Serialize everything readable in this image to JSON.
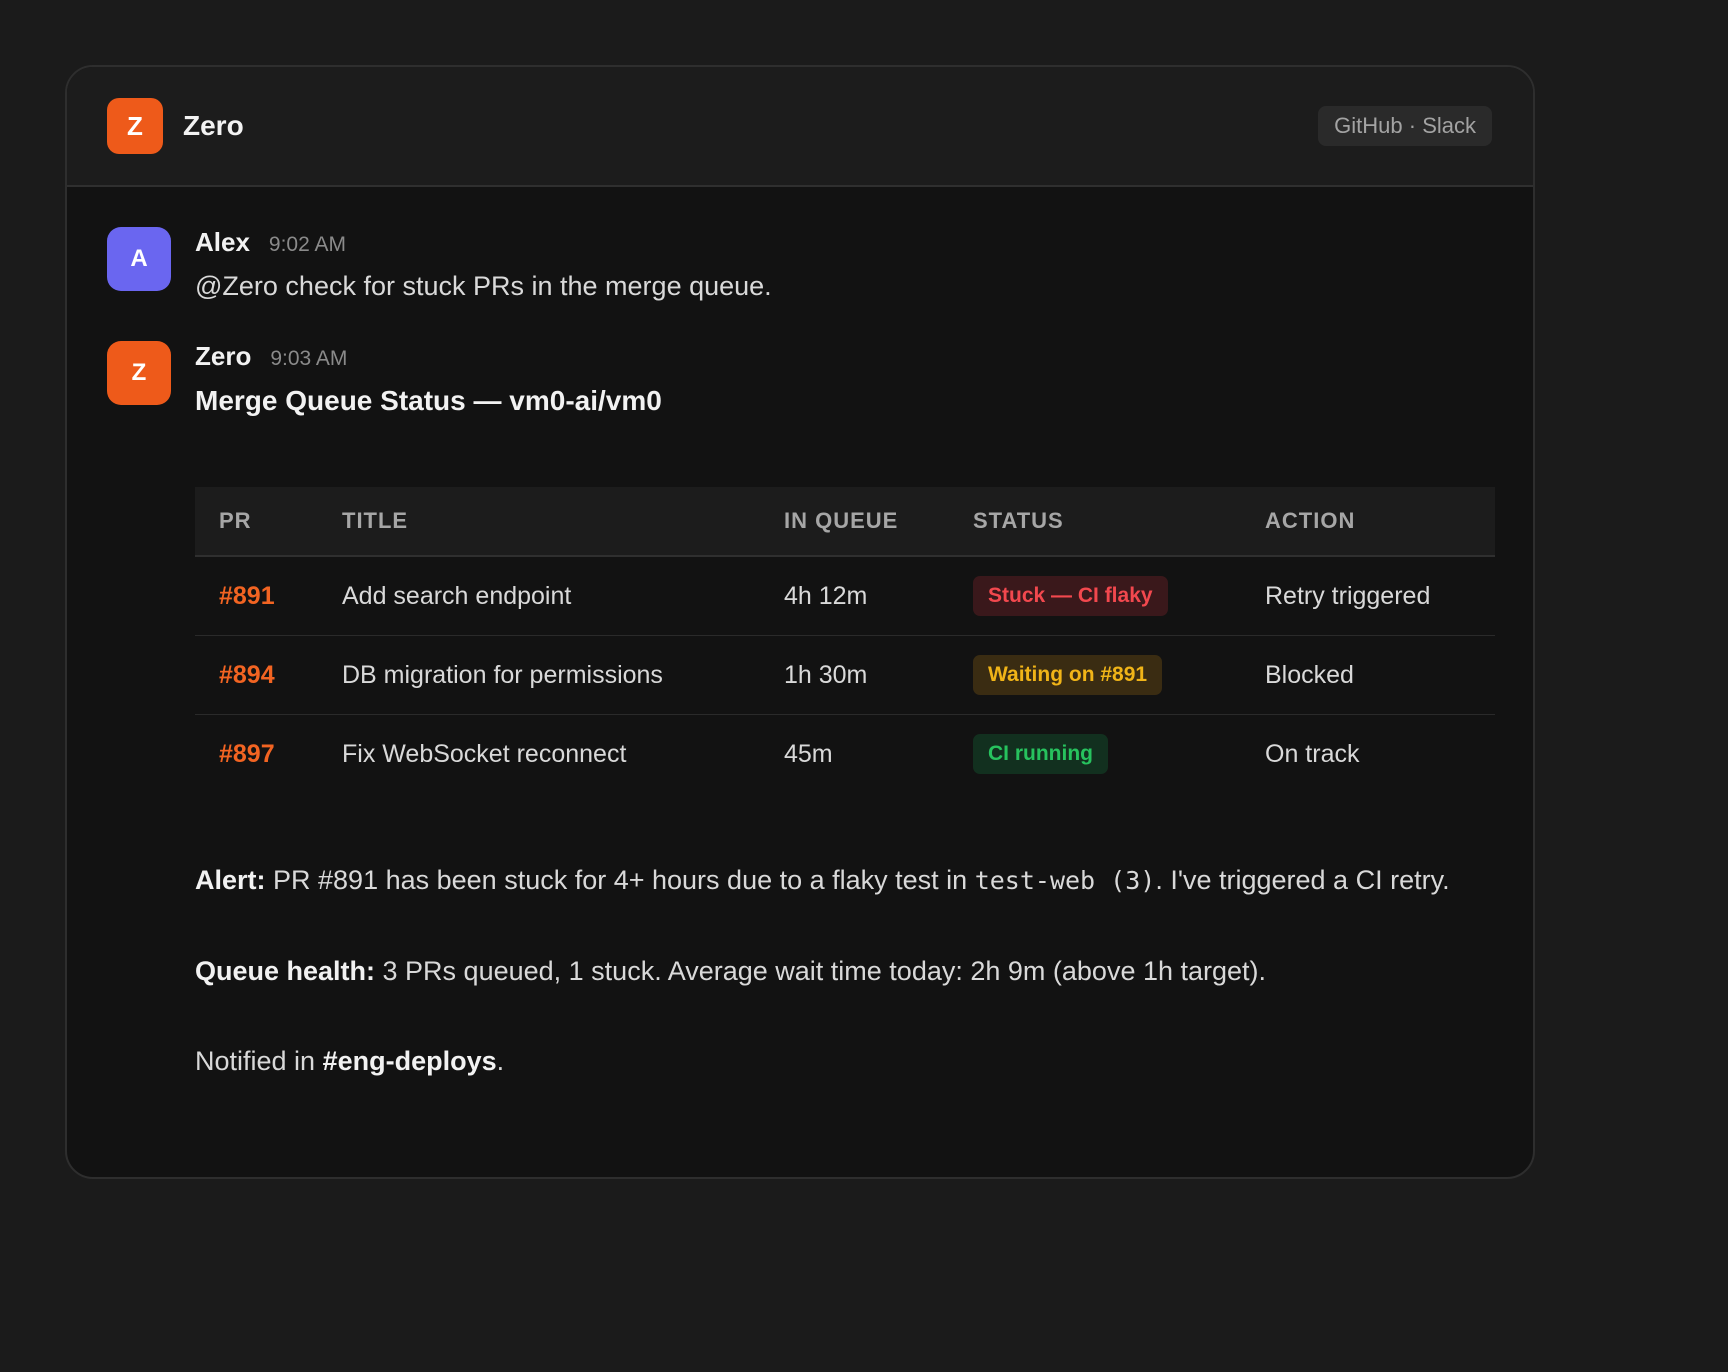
{
  "header": {
    "logo_letter": "Z",
    "app_name": "Zero",
    "integrations": "GitHub · Slack"
  },
  "messages": [
    {
      "avatar_letter": "A",
      "author": "Alex",
      "time": "9:02 AM",
      "text": "@Zero check for stuck PRs in the merge queue."
    },
    {
      "avatar_letter": "Z",
      "author": "Zero",
      "time": "9:03 AM",
      "heading": "Merge Queue Status — vm0-ai/vm0"
    }
  ],
  "table": {
    "columns": [
      "PR",
      "TITLE",
      "IN QUEUE",
      "STATUS",
      "ACTION"
    ],
    "rows": [
      {
        "pr": "#891",
        "title": "Add search endpoint",
        "in_queue": "4h 12m",
        "status": "Stuck — CI flaky",
        "status_color": "red",
        "action": "Retry triggered"
      },
      {
        "pr": "#894",
        "title": "DB migration for permissions",
        "in_queue": "1h 30m",
        "status": "Waiting on #891",
        "status_color": "yellow",
        "action": "Blocked"
      },
      {
        "pr": "#897",
        "title": "Fix WebSocket reconnect",
        "in_queue": "45m",
        "status": "CI running",
        "status_color": "green",
        "action": "On track"
      }
    ]
  },
  "alert": {
    "label": "Alert:",
    "text_before": " PR #891 has been stuck for 4+ hours due to a flaky test in ",
    "code": "test-web (3)",
    "text_after": ". I've triggered a CI retry."
  },
  "health": {
    "label": "Queue health:",
    "text": " 3 PRs queued, 1 stuck. Average wait time today: 2h 9m (above 1h target)."
  },
  "notified": {
    "prefix": "Notified in ",
    "channel": "#eng-deploys",
    "suffix": "."
  },
  "colors": {
    "accent": "#ee5a1a",
    "alex_avatar": "#6a66f0",
    "link": "#f26422",
    "status_red": "#f2484e",
    "status_yellow": "#f0b418",
    "status_green": "#27c25e"
  }
}
